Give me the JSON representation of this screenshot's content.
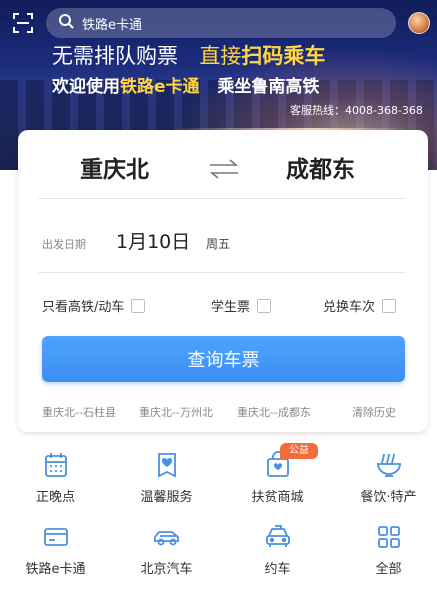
{
  "colors": {
    "accent": "#3b8ff0",
    "icon": "#4a90e2",
    "badge": "#f26b3a",
    "promo_highlight": "#ffd540"
  },
  "header": {
    "search_placeholder": "铁路e卡通",
    "scan_icon": "scan-icon",
    "search_icon": "search-icon"
  },
  "banner": {
    "line1_part1": "无需排队购票",
    "line1_part2": "直接",
    "line1_part3": "扫码乘车",
    "line2_part1": "欢迎使用",
    "line2_part2": "铁路e卡通",
    "line2_part3": "乘坐鲁南高铁",
    "hotline": "客服热线：4008-368-368"
  },
  "booking": {
    "from_station": "重庆北",
    "to_station": "成都东",
    "date_label": "出发日期",
    "date_value": "1月10日",
    "weekday": "周五",
    "options": [
      {
        "label": "只看高铁/动车",
        "checked": false
      },
      {
        "label": "学生票",
        "checked": false
      },
      {
        "label": "兑换车次",
        "checked": false
      }
    ],
    "query_button": "查询车票",
    "history": [
      "重庆北--石柱县",
      "重庆北--万州北",
      "重庆北--成都东"
    ],
    "clear_history": "清除历史"
  },
  "services": [
    {
      "label": "正晚点",
      "icon": "calendar-icon"
    },
    {
      "label": "温馨服务",
      "icon": "heart-card-icon"
    },
    {
      "label": "扶贫商城",
      "icon": "shop-bag-icon",
      "badge": "公益"
    },
    {
      "label": "餐饮·特产",
      "icon": "noodle-bowl-icon"
    },
    {
      "label": "铁路e卡通",
      "icon": "card-icon"
    },
    {
      "label": "北京汽车",
      "icon": "car-icon"
    },
    {
      "label": "约车",
      "icon": "taxi-icon"
    },
    {
      "label": "全部",
      "icon": "grid-icon"
    }
  ]
}
